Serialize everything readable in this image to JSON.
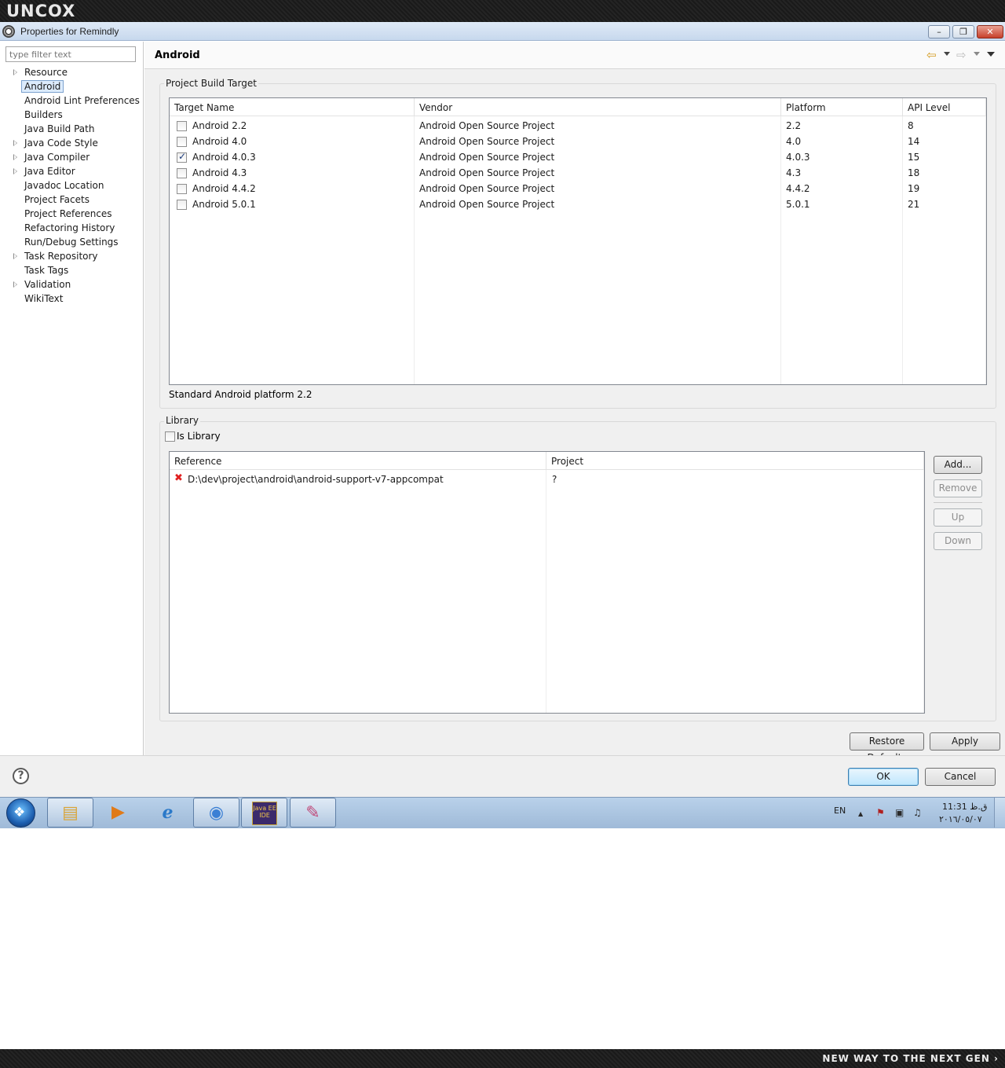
{
  "brand": {
    "logo_text": "UNCOX",
    "footer_text": "NEW WAY TO THE NEXT GEN ›"
  },
  "window": {
    "title": "Properties for Remindly",
    "icon": "settings-gear-icon",
    "controls": {
      "minimize": "–",
      "maximize": "❐",
      "close": "✕"
    }
  },
  "sidebar": {
    "filter_placeholder": "type filter text",
    "items": [
      {
        "label": "Resource",
        "expandable": true
      },
      {
        "label": "Android",
        "expandable": false,
        "selected": true
      },
      {
        "label": "Android Lint Preferences",
        "expandable": false
      },
      {
        "label": "Builders",
        "expandable": false
      },
      {
        "label": "Java Build Path",
        "expandable": false
      },
      {
        "label": "Java Code Style",
        "expandable": true
      },
      {
        "label": "Java Compiler",
        "expandable": true
      },
      {
        "label": "Java Editor",
        "expandable": true
      },
      {
        "label": "Javadoc Location",
        "expandable": false
      },
      {
        "label": "Project Facets",
        "expandable": false
      },
      {
        "label": "Project References",
        "expandable": false
      },
      {
        "label": "Refactoring History",
        "expandable": false
      },
      {
        "label": "Run/Debug Settings",
        "expandable": false
      },
      {
        "label": "Task Repository",
        "expandable": true
      },
      {
        "label": "Task Tags",
        "expandable": false
      },
      {
        "label": "Validation",
        "expandable": true
      },
      {
        "label": "WikiText",
        "expandable": false
      }
    ]
  },
  "page": {
    "title": "Android",
    "nav": {
      "back_icon": "⇦",
      "forward_icon": "⇨"
    }
  },
  "build_target": {
    "group_label": "Project Build Target",
    "columns": [
      "Target Name",
      "Vendor",
      "Platform",
      "API Level"
    ],
    "rows": [
      {
        "name": "Android 2.2",
        "vendor": "Android Open Source Project",
        "platform": "2.2",
        "api": "8",
        "checked": false
      },
      {
        "name": "Android 4.0",
        "vendor": "Android Open Source Project",
        "platform": "4.0",
        "api": "14",
        "checked": false
      },
      {
        "name": "Android 4.0.3",
        "vendor": "Android Open Source Project",
        "platform": "4.0.3",
        "api": "15",
        "checked": true
      },
      {
        "name": "Android 4.3",
        "vendor": "Android Open Source Project",
        "platform": "4.3",
        "api": "18",
        "checked": false
      },
      {
        "name": "Android 4.4.2",
        "vendor": "Android Open Source Project",
        "platform": "4.4.2",
        "api": "19",
        "checked": false
      },
      {
        "name": "Android 5.0.1",
        "vendor": "Android Open Source Project",
        "platform": "5.0.1",
        "api": "21",
        "checked": false
      }
    ],
    "description": "Standard Android platform 2.2"
  },
  "library": {
    "group_label": "Library",
    "is_library_label": "Is Library",
    "is_library_checked": false,
    "columns": [
      "Reference",
      "Project"
    ],
    "rows": [
      {
        "reference": "D:\\dev\\project\\android\\android-support-v7-appcompat",
        "project": "?",
        "status_icon": "error-x-icon",
        "status_glyph": "✖"
      }
    ],
    "buttons": {
      "add": "Add...",
      "remove": "Remove",
      "up": "Up",
      "down": "Down"
    }
  },
  "actions": {
    "restore_defaults": "Restore Defaults",
    "apply": "Apply",
    "ok": "OK",
    "cancel": "Cancel",
    "help_glyph": "?"
  },
  "taskbar": {
    "start_glyph": "❖",
    "apps": [
      {
        "name": "explorer",
        "glyph": "▤"
      },
      {
        "name": "media-player",
        "glyph": "▶"
      },
      {
        "name": "internet-explorer",
        "glyph": "e"
      },
      {
        "name": "chrome",
        "glyph": "◉"
      },
      {
        "name": "eclipse",
        "text": "Java EE IDE"
      },
      {
        "name": "paint",
        "glyph": "✎"
      }
    ],
    "language": "EN",
    "tray_icons": [
      "▲",
      "⚑",
      "▣",
      "♫"
    ],
    "clock_time": "ق.ظ 11:31",
    "clock_date": "٢٠١٦/٠٥/٠٧"
  }
}
